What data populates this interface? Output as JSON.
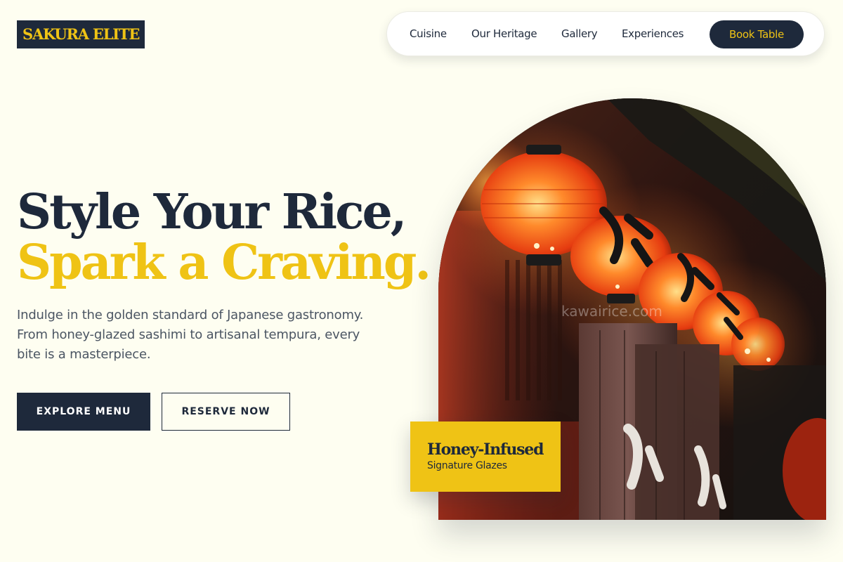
{
  "header": {
    "logo": "SAKURA ELITE",
    "nav": {
      "cuisine": "Cuisine",
      "heritage": "Our Heritage",
      "gallery": "Gallery",
      "experiences": "Experiences"
    },
    "cta": "Book Table"
  },
  "hero": {
    "title_line1": "Style Your Rice,",
    "title_line2": "Spark a Craving.",
    "description": "Indulge in the golden standard of Japanese gastronomy. From honey-glazed sashimi to artisanal tempura, every bite is a masterpiece.",
    "primary_button": "EXPLORE MENU",
    "secondary_button": "RESERVE NOW"
  },
  "image": {
    "subject": "glowing red paper lanterns and noren curtains",
    "watermark": "kawairice.com"
  },
  "badge": {
    "title": "Honey-Infused",
    "subtitle": "Signature Glazes"
  },
  "colors": {
    "background": "#FEFEF1",
    "navy": "#1E293B",
    "gold": "#EFC315",
    "body_text": "#4B5563"
  }
}
